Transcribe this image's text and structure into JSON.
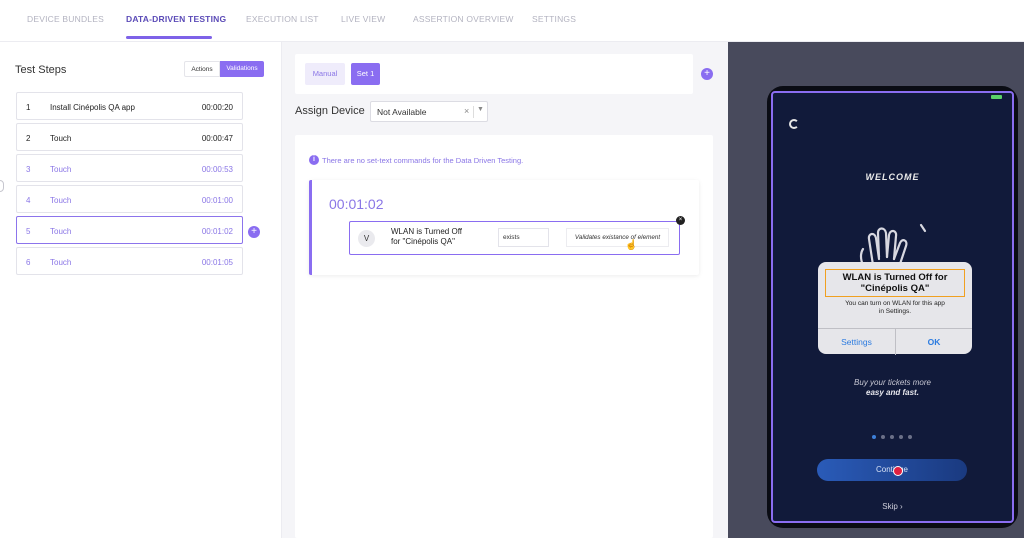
{
  "nav": {
    "tabs": [
      {
        "label": "DEVICE BUNDLES"
      },
      {
        "label": "DATA-DRIVEN TESTING"
      },
      {
        "label": "EXECUTION LIST"
      },
      {
        "label": "LIVE VIEW"
      },
      {
        "label": "ASSERTION OVERVIEW"
      },
      {
        "label": "SETTINGS"
      }
    ],
    "active_tab": "DATA-DRIVEN TESTING"
  },
  "steps_panel": {
    "title": "Test Steps",
    "toggle": {
      "actions": "Actions",
      "validations": "Validations",
      "selected": "Validations"
    },
    "steps": [
      {
        "num": "1",
        "name": "Install Cinépolis QA app",
        "time": "00:00:20"
      },
      {
        "num": "2",
        "name": "Touch",
        "time": "00:00:47"
      },
      {
        "num": "3",
        "name": "Touch",
        "time": "00:00:53"
      },
      {
        "num": "4",
        "name": "Touch",
        "time": "00:01:00"
      },
      {
        "num": "5",
        "name": "Touch",
        "time": "00:01:02"
      },
      {
        "num": "6",
        "name": "Touch",
        "time": "00:01:05"
      }
    ],
    "selected_step": "5",
    "add_label": "+"
  },
  "sets": {
    "manual": "Manual",
    "set1": "Set 1",
    "add_label": "+"
  },
  "assign": {
    "label": "Assign Device",
    "value": "Not Available",
    "clear": "×",
    "caret": "▼"
  },
  "content": {
    "info": "There are no set-text commands for the Data Driven Testing.",
    "info_icon": "i",
    "card": {
      "time": "00:01:02",
      "badge": "V",
      "title_line1": "WLAN is Turned Off",
      "title_line2": "for \"Cinépolis QA\"",
      "condition": "exists",
      "description": "Validates existance of element",
      "close": "×"
    }
  },
  "device": {
    "welcome": "WELCOME",
    "dialog": {
      "title_line1": "WLAN is Turned Off for",
      "title_line2": "\"Cinépolis QA\"",
      "message_line1": "You can turn on WLAN for this app",
      "message_line2": "in Settings.",
      "settings": "Settings",
      "ok": "OK"
    },
    "tagline_line1": "Buy your tickets more",
    "tagline_line2": "easy and fast.",
    "continue": "Continue",
    "skip": "Skip ›",
    "carousel": {
      "count": 5,
      "active": 1
    }
  },
  "colors": {
    "accent": "#8a6df1",
    "nav_active": "#5b4bb7",
    "device_bg": "#111a3a",
    "alert_highlight": "#f0a020"
  }
}
